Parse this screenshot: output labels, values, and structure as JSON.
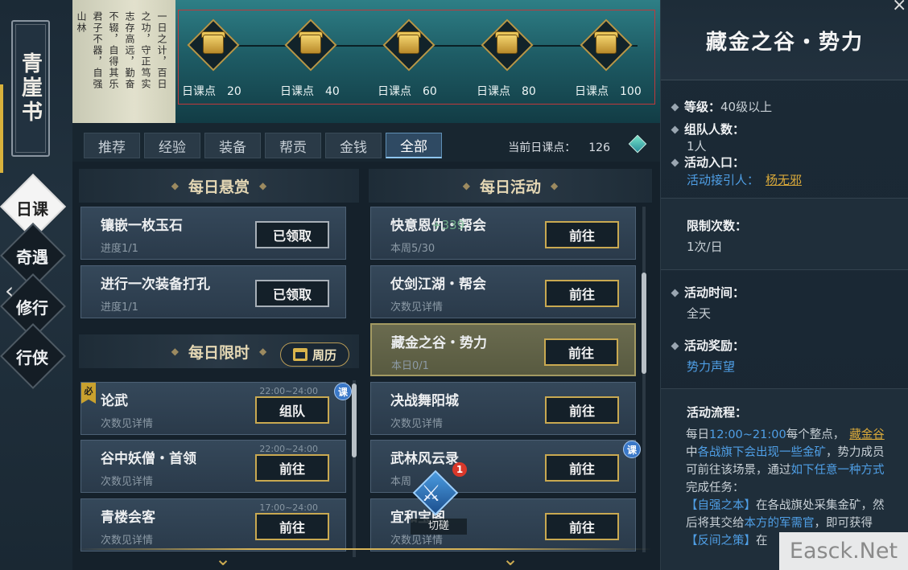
{
  "sidebar": {
    "book_title": "青崖书",
    "nav": [
      {
        "label": "日课",
        "active": true
      },
      {
        "label": "奇遇",
        "active": false
      },
      {
        "label": "修行",
        "active": false
      },
      {
        "label": "行侠",
        "active": false
      }
    ],
    "back_icon": "chevron-left-icon"
  },
  "banner": {
    "calligraphy": [
      "一日之计，百日",
      "之功，守正笃实",
      "志存高远，勤奋",
      "不辍，自得其乐",
      "君子不器，自强",
      "山林"
    ],
    "milestone_label": "日课点",
    "milestones": [
      {
        "points": "20"
      },
      {
        "points": "40"
      },
      {
        "points": "60"
      },
      {
        "points": "80"
      },
      {
        "points": "100"
      }
    ]
  },
  "tabs": [
    "推荐",
    "经验",
    "装备",
    "帮贡",
    "金钱",
    "全部"
  ],
  "active_tab": "全部",
  "points": {
    "label": "当前日课点：",
    "value": "126"
  },
  "left_column": {
    "daily_bounty_title": "每日悬赏",
    "daily_bounty": [
      {
        "title": "镶嵌一枚玉石",
        "sub": "进度1/1",
        "button": "已领取"
      },
      {
        "title": "进行一次装备打孔",
        "sub": "进度1/1",
        "button": "已领取"
      }
    ],
    "daily_limited_title": "每日限时",
    "calendar_label": "周历",
    "daily_limited": [
      {
        "title": "论武",
        "sub": "次数见详情",
        "time": "22:00~24:00",
        "button": "组队",
        "must": "必",
        "ke": "课"
      },
      {
        "title": "谷中妖僧・首领",
        "sub": "次数见详情",
        "time": "22:00~24:00",
        "button": "前往"
      },
      {
        "title": "青楼会客",
        "sub": "次数见详情",
        "time": "17:00~24:00",
        "button": "前往"
      }
    ]
  },
  "right_column": {
    "title": "每日活动",
    "items": [
      {
        "title": "快意恩仇・帮会",
        "sub": "本周5/30",
        "button": "前往"
      },
      {
        "title": "仗剑江湖・帮会",
        "sub": "次数见详情",
        "button": "前往"
      },
      {
        "title": "藏金之谷・势力",
        "sub": "本日0/1",
        "button": "前往"
      },
      {
        "title": "决战舞阳城",
        "sub": "次数见详情",
        "button": "前往"
      },
      {
        "title": "武林风云录",
        "sub": "本周",
        "button": "前往",
        "ke": "课"
      },
      {
        "title": "宜和宝阁",
        "sub": "次数见详情",
        "button": "前往"
      }
    ]
  },
  "floating": {
    "number": "+339",
    "spar_label": "切磋",
    "spar_badge": "1"
  },
  "detail": {
    "title": "藏金之谷・势力",
    "level_key": "等级：",
    "level_val": "40级以上",
    "team_key": "组队人数：",
    "team_val": "1人",
    "entry_key": "活动入口：",
    "entry_pre": "活动接引人：",
    "entry_npc": "杨无邪",
    "limit_key": "限制次数：",
    "limit_val": "1次/日",
    "time_key": "活动时间：",
    "time_val": "全天",
    "reward_key": "活动奖励：",
    "reward_val": "势力声望",
    "flow_key": "活动流程：",
    "flow_1": "每日",
    "flow_2": "12:00~21:00",
    "flow_3": "每个整点，",
    "flow_4": "藏金谷",
    "flow_5": "中",
    "flow_6": "各战旗下会出现一些金矿",
    "flow_7": "，势力成员可前往该场景，通过",
    "flow_8": "如下任意一种方式",
    "flow_9": "完成任务：",
    "flow_10": "【自强之本】",
    "flow_11": "在各战旗处采集金矿，然后将其交给",
    "flow_12": "本方的军需官",
    "flow_13": "，即可获得",
    "flow_14": "【反间之策】",
    "flow_15": "在"
  },
  "watermark": "Easck.Net"
}
